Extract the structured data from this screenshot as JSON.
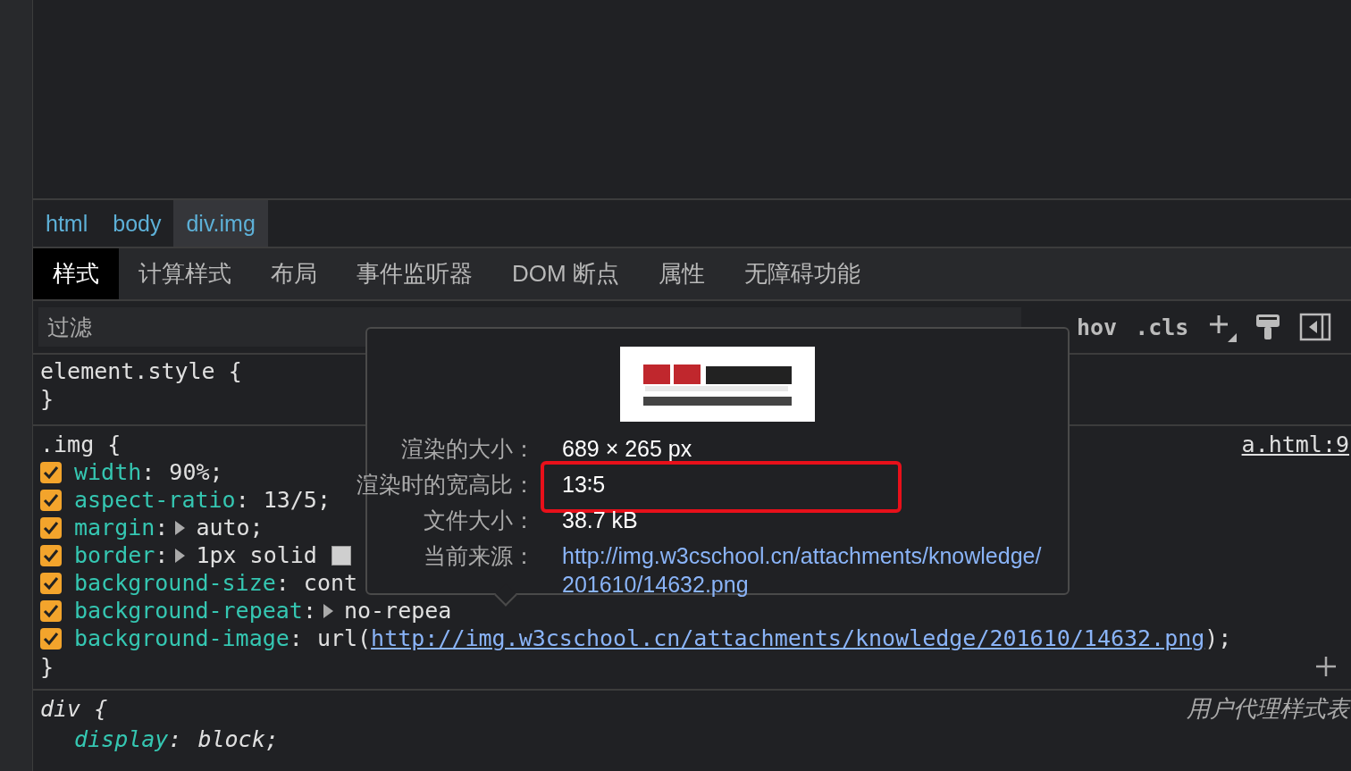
{
  "breadcrumbs": [
    {
      "label": "html",
      "selected": false
    },
    {
      "label": "body",
      "selected": false
    },
    {
      "label": "div.img",
      "selected": true
    }
  ],
  "tabs": [
    {
      "label": "样式",
      "selected": true
    },
    {
      "label": "计算样式",
      "selected": false
    },
    {
      "label": "布局",
      "selected": false
    },
    {
      "label": "事件监听器",
      "selected": false
    },
    {
      "label": "DOM 断点",
      "selected": false
    },
    {
      "label": "属性",
      "selected": false
    },
    {
      "label": "无障碍功能",
      "selected": false
    }
  ],
  "filter": {
    "placeholder": "过滤"
  },
  "toolbar": {
    "hov": "hov",
    "cls": ".cls"
  },
  "element_style": {
    "selector": "element.style {",
    "close": "}"
  },
  "img_rule": {
    "selector": ".img {",
    "source": "a.html:9",
    "close": "}",
    "properties": [
      {
        "name": "width",
        "colon": ":",
        "value": "90%;",
        "checked": true,
        "expandable": false
      },
      {
        "name": "aspect-ratio",
        "colon": ":",
        "value": "13/5;",
        "checked": true,
        "expandable": false
      },
      {
        "name": "margin",
        "colon": ":",
        "value": "auto;",
        "checked": true,
        "expandable": true
      },
      {
        "name": "border",
        "colon": ":",
        "value": "1px solid",
        "checked": true,
        "expandable": true,
        "color": "#cfcfcf"
      },
      {
        "name": "background-size",
        "colon": ":",
        "value": "cont",
        "checked": true,
        "expandable": false
      },
      {
        "name": "background-repeat",
        "colon": ":",
        "value": "no-repea",
        "checked": true,
        "expandable": true
      },
      {
        "name": "background-image",
        "colon": ":",
        "value": "url(",
        "link": "http://img.w3cschool.cn/attachments/knowledge/201610/14632.png",
        "after": ");",
        "checked": true,
        "expandable": false
      }
    ]
  },
  "div_rule": {
    "selector": "div {",
    "source": "用户代理样式表",
    "properties": [
      {
        "name": "display",
        "colon": ":",
        "value": "block;"
      }
    ]
  },
  "popover": {
    "rows": [
      {
        "label": "渲染的大小：",
        "value": "689 × 265 px",
        "kind": "text",
        "highlighted": false
      },
      {
        "label": "渲染时的宽高比：",
        "value": "13∶5",
        "kind": "text",
        "highlighted": true
      },
      {
        "label": "文件大小：",
        "value": "38.7 kB",
        "kind": "text",
        "highlighted": false
      },
      {
        "label": "当前来源：",
        "value": "http://img.w3cschool.cn/attachments/knowledge/201610/14632.png",
        "kind": "link",
        "highlighted": false
      }
    ]
  }
}
